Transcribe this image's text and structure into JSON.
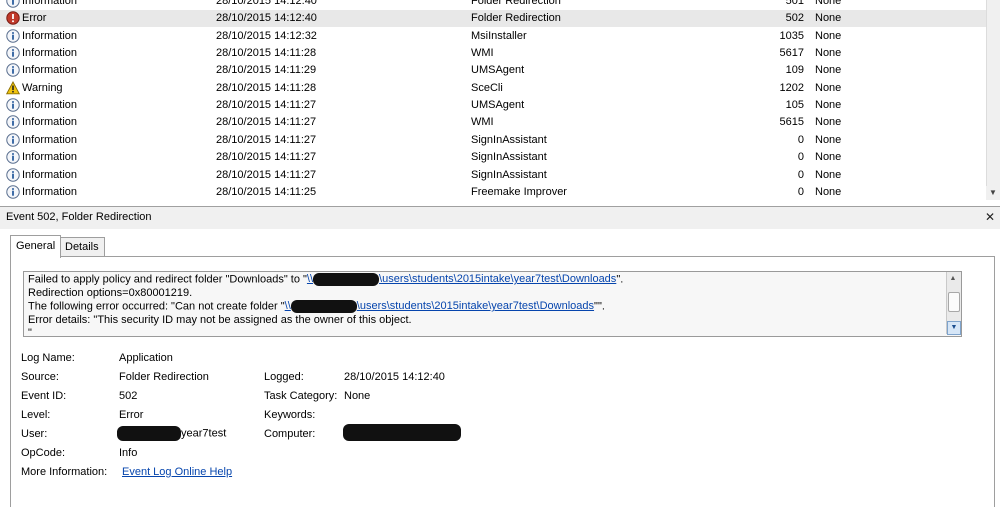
{
  "event_list": {
    "rows": [
      {
        "level": "Information",
        "icon": "info-icon",
        "date": "28/10/2015 14:12:40",
        "source": "Folder Redirection",
        "event_id": "501",
        "task": "None"
      },
      {
        "level": "Error",
        "icon": "error-icon",
        "date": "28/10/2015 14:12:40",
        "source": "Folder Redirection",
        "event_id": "502",
        "task": "None",
        "selected": true
      },
      {
        "level": "Information",
        "icon": "info-icon",
        "date": "28/10/2015 14:12:32",
        "source": "MsiInstaller",
        "event_id": "1035",
        "task": "None"
      },
      {
        "level": "Information",
        "icon": "info-icon",
        "date": "28/10/2015 14:11:28",
        "source": "WMI",
        "event_id": "5617",
        "task": "None"
      },
      {
        "level": "Information",
        "icon": "info-icon",
        "date": "28/10/2015 14:11:29",
        "source": "UMSAgent",
        "event_id": "109",
        "task": "None"
      },
      {
        "level": "Warning",
        "icon": "warning-icon",
        "date": "28/10/2015 14:11:28",
        "source": "SceCli",
        "event_id": "1202",
        "task": "None"
      },
      {
        "level": "Information",
        "icon": "info-icon",
        "date": "28/10/2015 14:11:27",
        "source": "UMSAgent",
        "event_id": "105",
        "task": "None"
      },
      {
        "level": "Information",
        "icon": "info-icon",
        "date": "28/10/2015 14:11:27",
        "source": "WMI",
        "event_id": "5615",
        "task": "None"
      },
      {
        "level": "Information",
        "icon": "info-icon",
        "date": "28/10/2015 14:11:27",
        "source": "SignInAssistant",
        "event_id": "0",
        "task": "None"
      },
      {
        "level": "Information",
        "icon": "info-icon",
        "date": "28/10/2015 14:11:27",
        "source": "SignInAssistant",
        "event_id": "0",
        "task": "None"
      },
      {
        "level": "Information",
        "icon": "info-icon",
        "date": "28/10/2015 14:11:27",
        "source": "SignInAssistant",
        "event_id": "0",
        "task": "None"
      },
      {
        "level": "Information",
        "icon": "info-icon",
        "date": "28/10/2015 14:11:25",
        "source": "Freemake Improver",
        "event_id": "0",
        "task": "None"
      }
    ]
  },
  "detail": {
    "title": "Event 502, Folder Redirection",
    "tabs": {
      "general": "General",
      "details": "Details"
    },
    "description": {
      "line1_prefix": "Failed to apply policy and redirect folder \"Downloads\" to \"",
      "line1_link_start": "\\\\",
      "line1_link_path": "\\users\\students\\2015intake\\year7test\\Downloads",
      "line1_suffix": "\".",
      "line2": " Redirection options=0x80001219.",
      "line3_prefix": " The following error occurred: \"Can not create folder \"",
      "line3_link_start": "\\\\",
      "line3_link_path": "\\users\\students\\2015intake\\year7test\\Downloads",
      "line3_suffix": "\"\".",
      "line4": " Error details: \"This security ID may not be assigned as the owner of this object.",
      "line5": "\""
    },
    "properties": {
      "log_name_label": "Log Name:",
      "log_name": "Application",
      "source_label": "Source:",
      "source": "Folder Redirection",
      "logged_label": "Logged:",
      "logged": "28/10/2015 14:12:40",
      "event_id_label": "Event ID:",
      "event_id": "502",
      "task_category_label": "Task Category:",
      "task_category": "None",
      "level_label": "Level:",
      "level": "Error",
      "keywords_label": "Keywords:",
      "keywords": "",
      "user_label": "User:",
      "user_suffix": "year7test",
      "computer_label": "Computer:",
      "opcode_label": "OpCode:",
      "opcode": "Info",
      "more_info_label": "More Information:",
      "more_info_link": "Event Log Online Help"
    }
  },
  "colors": {
    "selected_row": "#e8e8e8",
    "link": "#0645ad",
    "error": "#c0392b",
    "warning": "#f1c40f",
    "info": "#2b5d9e"
  }
}
